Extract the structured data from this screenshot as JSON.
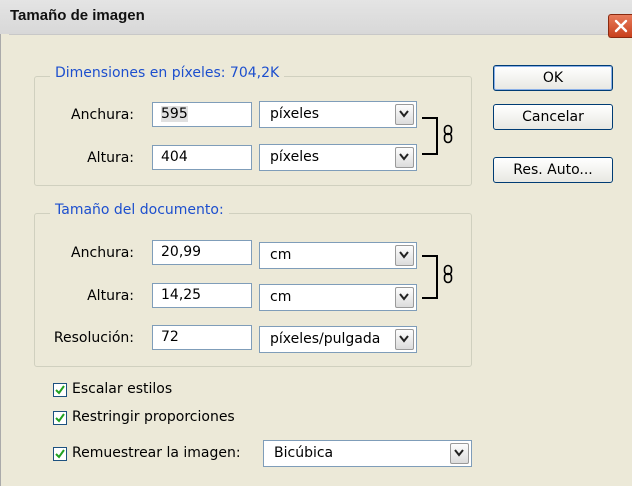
{
  "window": {
    "title": "Tamaño de imagen"
  },
  "pixel_dimensions": {
    "legend": "Dimensiones en píxeles: 704,2K",
    "width_label": "Anchura:",
    "width_value": "595",
    "width_unit": "píxeles",
    "height_label": "Altura:",
    "height_value": "404",
    "height_unit": "píxeles"
  },
  "document_size": {
    "legend": "Tamaño del documento:",
    "width_label": "Anchura:",
    "width_value": "20,99",
    "width_unit": "cm",
    "height_label": "Altura:",
    "height_value": "14,25",
    "height_unit": "cm",
    "resolution_label": "Resolución:",
    "resolution_value": "72",
    "resolution_unit": "píxeles/pulgada"
  },
  "options": {
    "scale_styles": {
      "label": "Escalar estilos",
      "checked": true
    },
    "constrain": {
      "label": "Restringir proporciones",
      "checked": true
    },
    "resample": {
      "label": "Remuestrear la imagen:",
      "checked": true,
      "method": "Bicúbica"
    }
  },
  "buttons": {
    "ok": "OK",
    "cancel": "Cancelar",
    "auto": "Res. Auto..."
  },
  "icons": {
    "close": "close-icon",
    "link": "chain-link-icon",
    "dropdown": "chevron-down-icon",
    "check": "checkmark-icon"
  },
  "colors": {
    "legend": "#1d4fce",
    "close_button": "#c8401c",
    "background": "#ece9d8"
  }
}
